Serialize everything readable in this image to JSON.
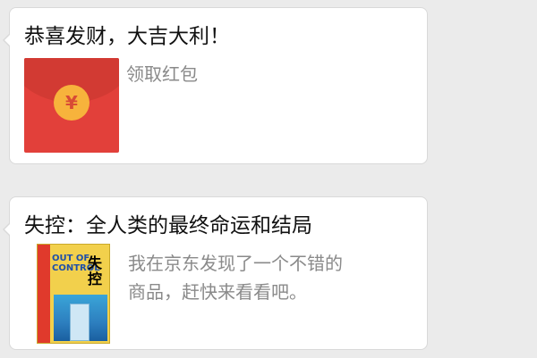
{
  "messages": [
    {
      "title": "恭喜发财，大吉大利！",
      "subtitle": "领取红包",
      "icon": "red-packet-icon",
      "coin_symbol": "¥"
    },
    {
      "title": "失控：全人类的最终命运和结局",
      "subtitle_line1": "我在京东发现了一个不错的",
      "subtitle_line2": "商品，赶快来看看吧。",
      "thumbnail": "book-cover-image",
      "cover_text_en": "OUT OF CONTROL",
      "cover_text_cn": "失控"
    }
  ],
  "colors": {
    "background": "#ebebeb",
    "bubble": "#ffffff",
    "red_packet": "#e2403a",
    "coin": "#f7b33c",
    "subtitle": "#8a8a8a"
  }
}
